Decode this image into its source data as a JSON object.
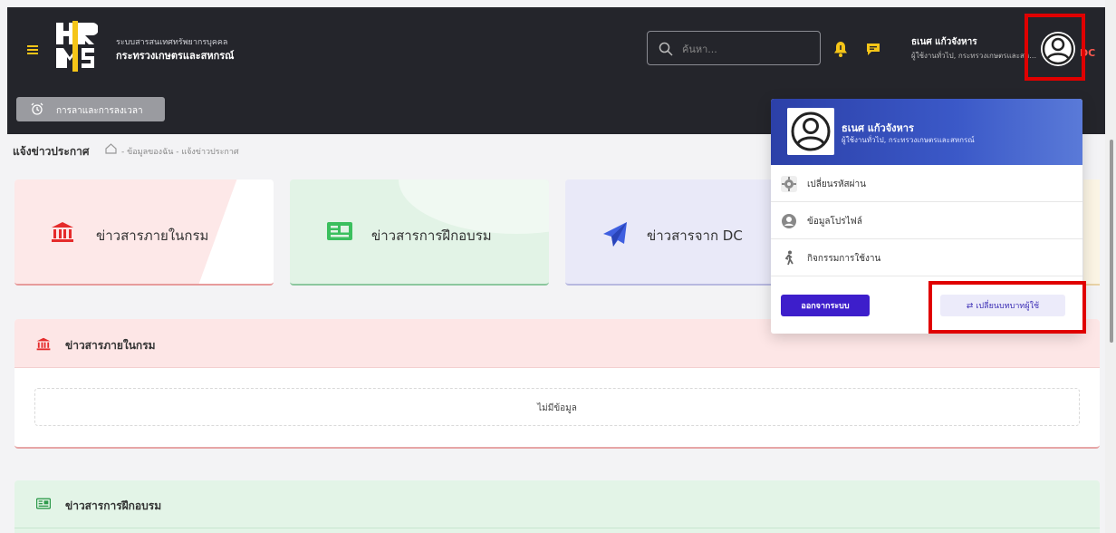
{
  "header": {
    "org_sub": "ระบบสารสนเทศทรัพยากรบุคคล",
    "org_main": "กระทรวงเกษตรและสหกรณ์",
    "search_placeholder": "ค้นหา...",
    "user_name": "ธเนศ แก้วจังหาร",
    "user_role": "ผู้ใช้งานทั่วไป, กระทรวงเกษตรและสหกรณ์",
    "truncated_label": "DC"
  },
  "subbar": {
    "leave_button": "การลาและการลงเวลา"
  },
  "breadcrumb": {
    "title": "แจ้งข่าวประกาศ",
    "path": "- ข้อมูลของฉัน - แจ้งข่าวประกาศ"
  },
  "cards": [
    {
      "label": "ข่าวสารภายในกรม",
      "icon": "bank-icon"
    },
    {
      "label": "ข่าวสารการฝึกอบรม",
      "icon": "newspaper-icon"
    },
    {
      "label": "ข่าวสารจาก DC",
      "icon": "paper-plane-icon"
    }
  ],
  "sections": {
    "internal_title": "ข่าวสารภายในกรม",
    "no_data": "ไม่มีข้อมูล",
    "training_title": "ข่าวสารการฝึกอบรม"
  },
  "dropdown": {
    "name": "ธเนศ แก้วจังหาร",
    "role": "ผู้ใช้งานทั่วไป, กระทรวงเกษตรและสหกรณ์",
    "items": [
      {
        "label": "เปลี่ยนรหัสผ่าน",
        "icon": "gear-icon"
      },
      {
        "label": "ข้อมูลโปรไฟล์",
        "icon": "user-icon"
      },
      {
        "label": "กิจกรรมการใช้งาน",
        "icon": "walking-icon"
      }
    ],
    "logout": "ออกจากระบบ",
    "switch_role": "⇄  เปลี่ยนบทบาทผู้ใช้"
  },
  "colors": {
    "header_bg": "#24252b",
    "accent_yellow": "#f5c518",
    "dropdown_blue": "#2c40a8",
    "logout_purple": "#3d1ecb",
    "highlight_red": "#e00000"
  }
}
